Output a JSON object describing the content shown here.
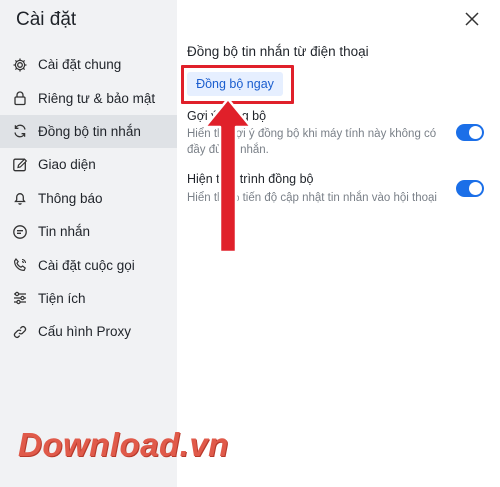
{
  "sidebar": {
    "title": "Cài đặt",
    "items": [
      {
        "label": "Cài đặt chung",
        "icon": "gear-icon"
      },
      {
        "label": "Riêng tư & bảo mật",
        "icon": "lock-icon"
      },
      {
        "label": "Đồng bộ tin nhắn",
        "icon": "sync-icon",
        "active": true
      },
      {
        "label": "Giao diện",
        "icon": "edit-icon"
      },
      {
        "label": "Thông báo",
        "icon": "bell-icon"
      },
      {
        "label": "Tin nhắn",
        "icon": "message-icon"
      },
      {
        "label": "Cài đặt cuộc gọi",
        "icon": "phone-icon"
      },
      {
        "label": "Tiện ích",
        "icon": "sliders-icon"
      },
      {
        "label": "Cấu hình Proxy",
        "icon": "link-icon"
      }
    ]
  },
  "main": {
    "section_title": "Đồng bộ tin nhắn từ điện thoại",
    "sync_now_label": "Đồng bộ ngay",
    "settings": [
      {
        "title": "Gợi ý đồng bộ",
        "desc_line1": "Hiển thị gợi ý đồng bộ khi máy tính này không có",
        "desc_line2": "đầy đủ tin nhắn.",
        "enabled": true
      },
      {
        "title": "Hiện tiến trình đồng bộ",
        "desc_line1": "Hiển thị % tiến độ cập nhật tin nhắn vào hội thoại",
        "desc_line2": "",
        "enabled": true
      }
    ]
  },
  "watermark": "Download.vn",
  "colors": {
    "accent": "#1b6fe8",
    "highlight": "#e0202a",
    "sidebar_bg": "#f1f2f4"
  }
}
